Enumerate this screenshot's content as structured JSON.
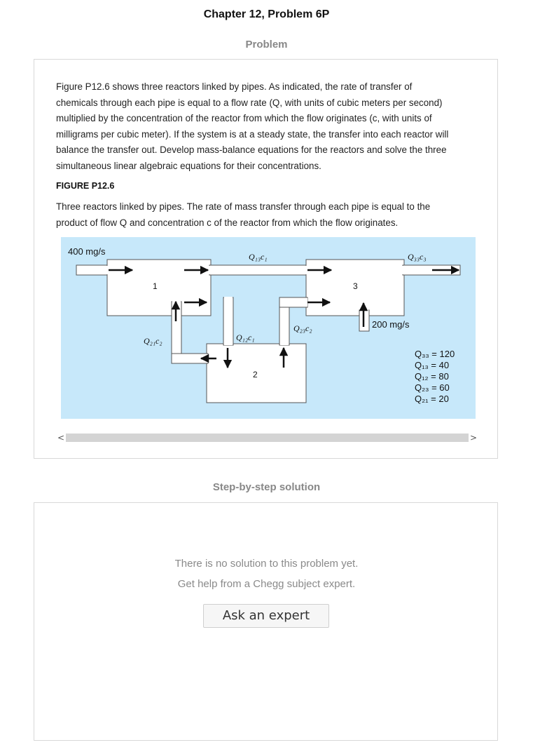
{
  "header": {
    "title": "Chapter 12, Problem 6P"
  },
  "problem": {
    "heading": "Problem",
    "paragraph_lines": [
      "Figure P12.6 shows three reactors linked by pipes. As indicated, the rate of transfer of",
      "chemicals through each pipe is equal to a flow rate (Q, with units of cubic meters per second)",
      "multiplied by the concentration of the reactor from which the flow originates (c, with units of",
      "milligrams per cubic meter). If the system is at a steady state, the transfer into each reactor will",
      "balance the transfer out. Develop mass-balance equations for the reactors and solve the three",
      "simultaneous linear algebraic equations for their concentrations."
    ],
    "figure_label": "FIGURE P12.6",
    "caption_lines": [
      "Three reactors linked by pipes. The rate of mass transfer through each pipe is equal to the",
      "product of flow Q and concentration c of the reactor from which the flow originates."
    ]
  },
  "figure": {
    "inflow_1": "400 mg/s",
    "inflow_3": "200 mg/s",
    "reactor_labels": [
      "1",
      "2",
      "3"
    ],
    "flows": {
      "q13c1": "Q₁₃c₁",
      "q33c3": "Q₃₃c₃",
      "q21c2": "Q₂₁c₂",
      "q12c1": "Q₁₂c₁",
      "q23c2": "Q₂₃c₂"
    },
    "values": [
      "Q₃₃ = 120",
      "Q₁₃ = 40",
      "Q₁₂ = 80",
      "Q₂₃ = 60",
      "Q₂₁ = 20"
    ]
  },
  "scrollbar": {
    "left": "<",
    "right": ">"
  },
  "solution": {
    "heading": "Step-by-step solution",
    "line1": "There is no solution to this problem yet.",
    "line2": "Get help from a Chegg subject expert.",
    "button": "Ask an expert"
  }
}
